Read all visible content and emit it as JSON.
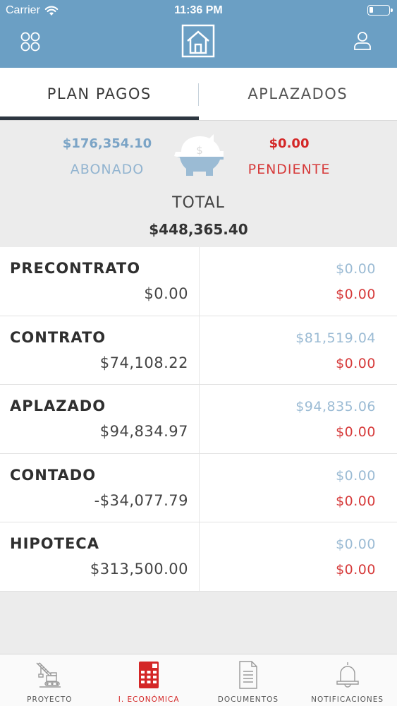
{
  "status_bar": {
    "carrier": "Carrier",
    "time": "11:36 PM"
  },
  "nav": {
    "menu_icon": "grid-icon",
    "logo_icon": "house-logo-icon",
    "user_icon": "user-icon"
  },
  "tabs": [
    {
      "label": "PLAN PAGOS",
      "active": true
    },
    {
      "label": "APLAZADOS",
      "active": false
    }
  ],
  "summary": {
    "abonado_amount": "$176,354.10",
    "abonado_label": "ABONADO",
    "pendiente_amount": "$0.00",
    "pendiente_label": "PENDIENTE",
    "total_label": "TOTAL",
    "total_amount": "$448,365.40",
    "icon": "piggy-bank-icon"
  },
  "rows": [
    {
      "name": "PRECONTRATO",
      "amount": "$0.00",
      "paid": "$0.00",
      "due": "$0.00"
    },
    {
      "name": "CONTRATO",
      "amount": "$74,108.22",
      "paid": "$81,519.04",
      "due": "$0.00"
    },
    {
      "name": "APLAZADO",
      "amount": "$94,834.97",
      "paid": "$94,835.06",
      "due": "$0.00"
    },
    {
      "name": "CONTADO",
      "amount": "-$34,077.79",
      "paid": "$0.00",
      "due": "$0.00"
    },
    {
      "name": "HIPOTECA",
      "amount": "$313,500.00",
      "paid": "$0.00",
      "due": "$0.00"
    }
  ],
  "tabbar": [
    {
      "label": "PROYECTO",
      "icon": "crane-icon",
      "active": false
    },
    {
      "label": "I. ECONÓMICA",
      "icon": "calculator-icon",
      "active": true
    },
    {
      "label": "DOCUMENTOS",
      "icon": "document-icon",
      "active": false
    },
    {
      "label": "NOTIFICACIONES",
      "icon": "bell-icon",
      "active": false
    }
  ],
  "colors": {
    "header": "#6b9fc4",
    "paid": "#9bbbd4",
    "due": "#d42727",
    "active_tab": "#2d3640"
  }
}
